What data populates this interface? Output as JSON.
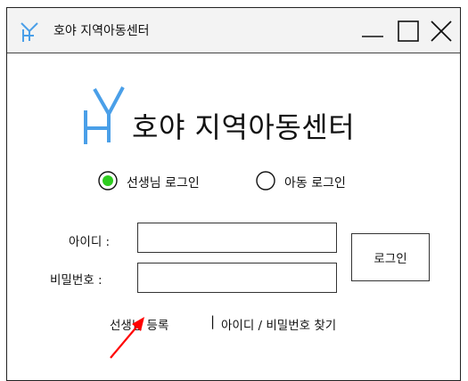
{
  "window": {
    "title": "호야 지역아동센터"
  },
  "brand": {
    "logo_letter": "H",
    "name": "호야 지역아동센터"
  },
  "login_type": {
    "teacher_label": "선생님 로그인",
    "child_label": "아동 로그인",
    "selected": "teacher"
  },
  "form": {
    "id_label": "아이디 :",
    "id_value": "",
    "password_label": "비밀번호 :",
    "password_value": "",
    "login_button": "로그인"
  },
  "links": {
    "register": "선생님 등록",
    "divider": "|",
    "find": "아이디 / 비밀번호 찾기"
  },
  "colors": {
    "logo_blue": "#4a9fe8",
    "radio_selected": "#2ecc1f",
    "annotation_arrow": "#ff0000"
  },
  "icons": {
    "minimize": "minimize-icon",
    "maximize": "maximize-icon",
    "close": "close-icon",
    "annotation": "arrow-annotation"
  }
}
